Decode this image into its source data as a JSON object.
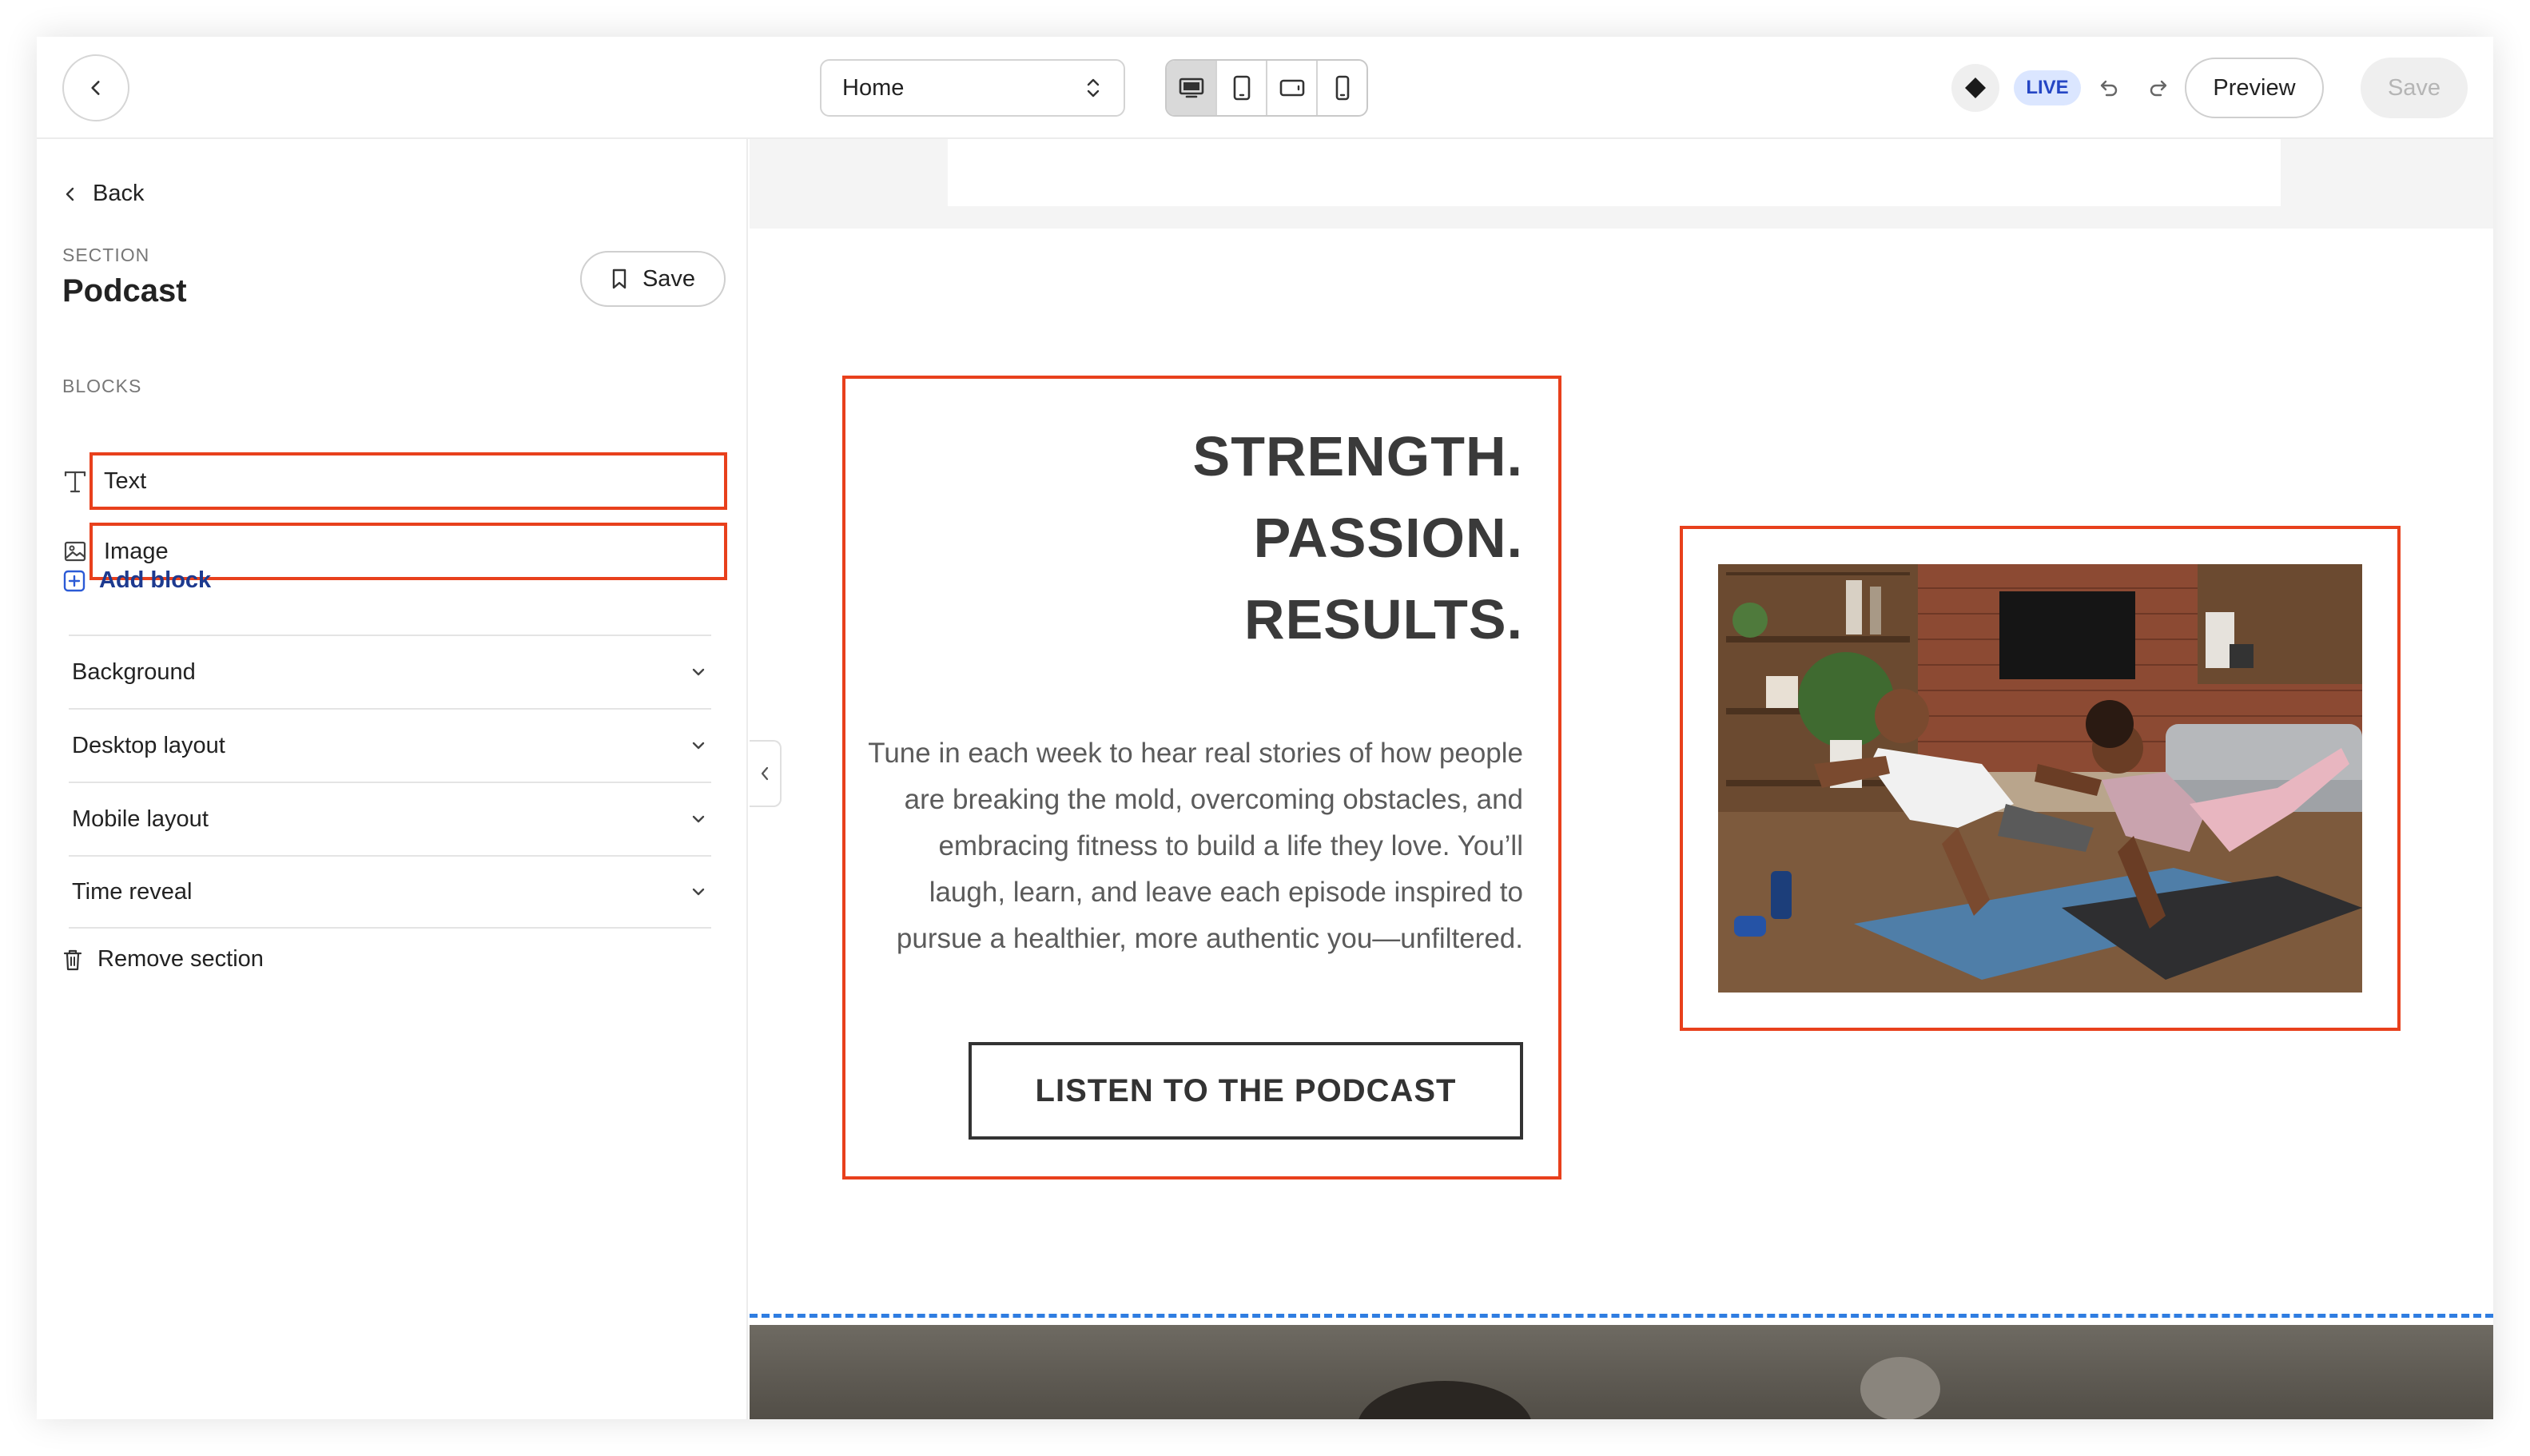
{
  "topbar": {
    "page_select": "Home",
    "live_badge": "LIVE",
    "preview_label": "Preview",
    "save_label": "Save",
    "devices": [
      "desktop-icon",
      "tablet-portrait-icon",
      "tablet-landscape-icon",
      "mobile-icon"
    ]
  },
  "sidebar": {
    "back_label": "Back",
    "section_label": "SECTION",
    "section_title": "Podcast",
    "save_label": "Save",
    "blocks_label": "BLOCKS",
    "blocks": [
      {
        "label": "Text",
        "icon": "text-type-icon"
      },
      {
        "label": "Image",
        "icon": "image-icon"
      }
    ],
    "add_block_label": "Add block",
    "accordions": [
      {
        "label": "Background"
      },
      {
        "label": "Desktop layout"
      },
      {
        "label": "Mobile layout"
      },
      {
        "label": "Time reveal"
      }
    ],
    "remove_label": "Remove section"
  },
  "canvas": {
    "headline_line1": "STRENGTH.",
    "headline_line2": "PASSION.",
    "headline_line3": "RESULTS.",
    "body": "Tune in each week to hear real stories of how people are breaking the mold, overcoming obstacles, and embracing fitness to build a life they love. You’ll laugh, learn, and leave each episode inspired to pursue a healthier, more authentic you—unfiltered.",
    "cta_label": "LISTEN TO THE PODCAST"
  },
  "colors": {
    "selection": "#e8401c",
    "accent_blue": "#1d3a8f",
    "live_bg": "#dbe6ff",
    "divider": "#2f7de1"
  }
}
